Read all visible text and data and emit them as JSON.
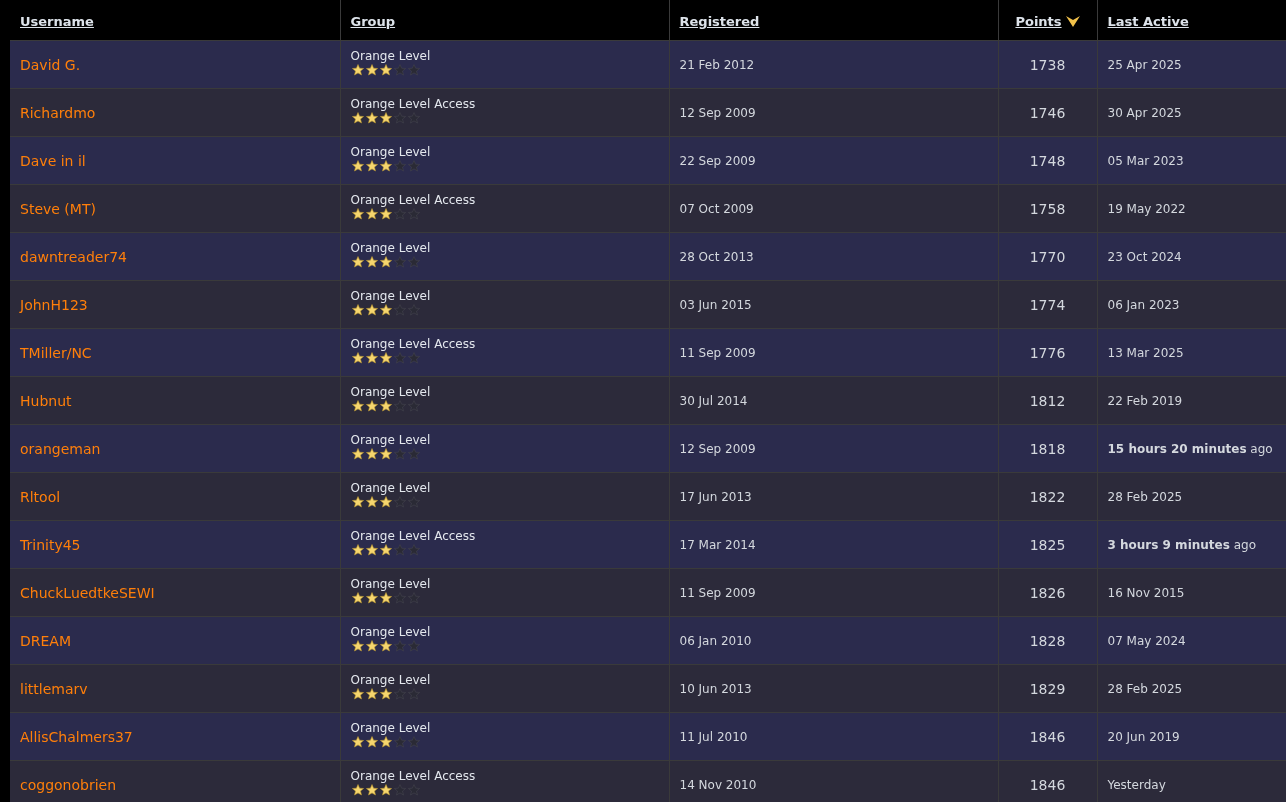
{
  "table": {
    "columns": [
      {
        "label": "Username",
        "sorted": false
      },
      {
        "label": "Group",
        "sorted": false
      },
      {
        "label": "Registered",
        "sorted": false
      },
      {
        "label": "Points",
        "sorted": true
      },
      {
        "label": "Last Active",
        "sorted": false
      }
    ],
    "rows": [
      {
        "username": "David G.",
        "group": "Orange Level",
        "stars": 3,
        "registered": "21 Feb 2012",
        "points": "1738",
        "last_active": "25 Apr 2025"
      },
      {
        "username": "Richardmo",
        "group": "Orange Level Access",
        "stars": 3,
        "registered": "12 Sep 2009",
        "points": "1746",
        "last_active": "30 Apr 2025"
      },
      {
        "username": "Dave in il",
        "group": "Orange Level",
        "stars": 3,
        "registered": "22 Sep 2009",
        "points": "1748",
        "last_active": "05 Mar 2023"
      },
      {
        "username": "Steve (MT)",
        "group": "Orange Level Access",
        "stars": 3,
        "registered": "07 Oct 2009",
        "points": "1758",
        "last_active": "19 May 2022"
      },
      {
        "username": "dawntreader74",
        "group": "Orange Level",
        "stars": 3,
        "registered": "28 Oct 2013",
        "points": "1770",
        "last_active": "23 Oct 2024"
      },
      {
        "username": "JohnH123",
        "group": "Orange Level",
        "stars": 3,
        "registered": "03 Jun 2015",
        "points": "1774",
        "last_active": "06 Jan 2023"
      },
      {
        "username": "TMiller/NC",
        "group": "Orange Level Access",
        "stars": 3,
        "registered": "11 Sep 2009",
        "points": "1776",
        "last_active": "13 Mar 2025"
      },
      {
        "username": "Hubnut",
        "group": "Orange Level",
        "stars": 3,
        "registered": "30 Jul 2014",
        "points": "1812",
        "last_active": "22 Feb 2019"
      },
      {
        "username": "orangeman",
        "group": "Orange Level",
        "stars": 3,
        "registered": "12 Sep 2009",
        "points": "1818",
        "last_active": "**15 hours 20 minutes** ago"
      },
      {
        "username": "Rltool",
        "group": "Orange Level",
        "stars": 3,
        "registered": "17 Jun 2013",
        "points": "1822",
        "last_active": "28 Feb 2025"
      },
      {
        "username": "Trinity45",
        "group": "Orange Level Access",
        "stars": 3,
        "registered": "17 Mar 2014",
        "points": "1825",
        "last_active": "**3 hours 9 minutes** ago"
      },
      {
        "username": "ChuckLuedtkeSEWI",
        "group": "Orange Level",
        "stars": 3,
        "registered": "11 Sep 2009",
        "points": "1826",
        "last_active": "16 Nov 2015"
      },
      {
        "username": "DREAM",
        "group": "Orange Level",
        "stars": 3,
        "registered": "06 Jan 2010",
        "points": "1828",
        "last_active": "07 May 2024"
      },
      {
        "username": "littlemarv",
        "group": "Orange Level",
        "stars": 3,
        "registered": "10 Jun 2013",
        "points": "1829",
        "last_active": "28 Feb 2025"
      },
      {
        "username": "AllisChalmers37",
        "group": "Orange Level",
        "stars": 3,
        "registered": "11 Jul 2010",
        "points": "1846",
        "last_active": "20 Jun 2019"
      },
      {
        "username": "coggonobrien",
        "group": "Orange Level Access",
        "stars": 3,
        "registered": "14 Nov 2010",
        "points": "1846",
        "last_active": "Yesterday"
      }
    ]
  }
}
